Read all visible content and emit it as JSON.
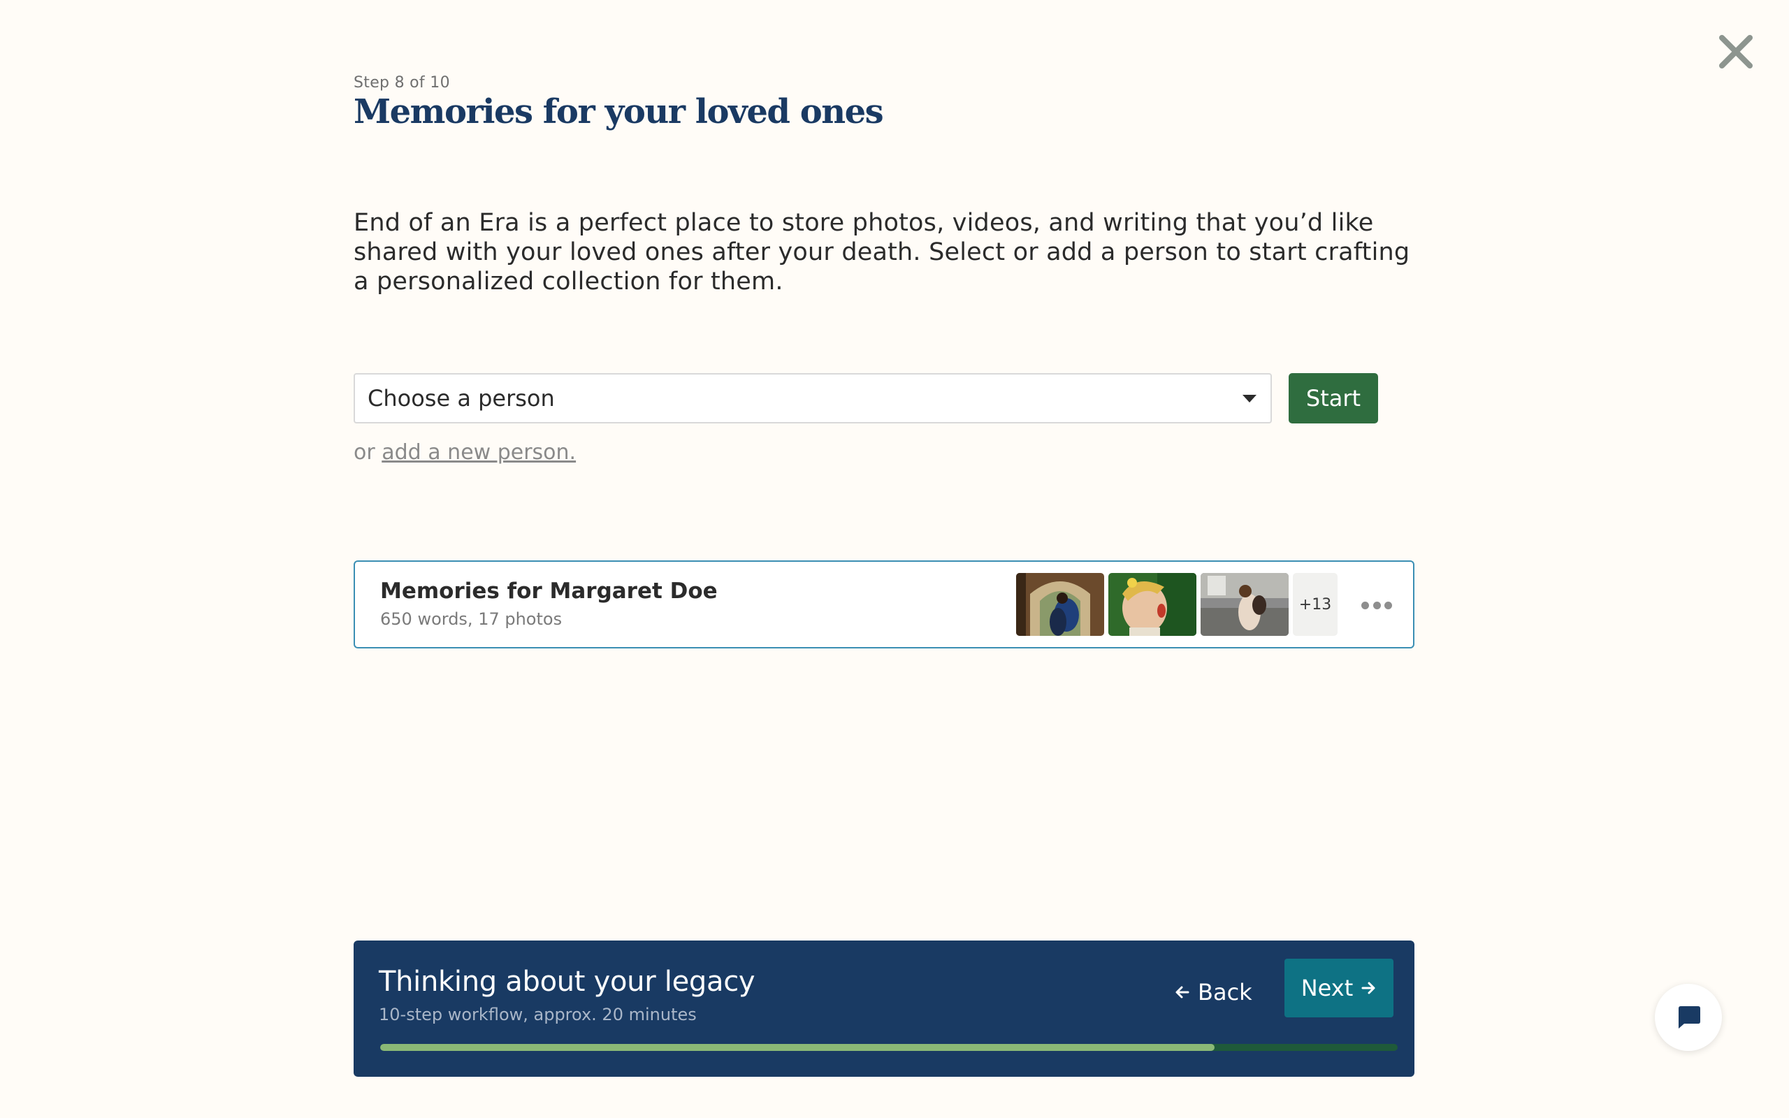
{
  "header": {
    "step_label": "Step 8 of 10",
    "title": "Memories for your loved ones",
    "close_icon": "close-x-icon"
  },
  "intro": {
    "text": "End of an Era is a perfect place to store photos, videos, and writing that you’d like shared with your loved ones after your death. Select or add a person to start crafting a personalized collection for them."
  },
  "person_picker": {
    "selected": "Choose a person",
    "start_label": "Start",
    "or_prefix": "or",
    "add_link": "add a new person."
  },
  "memory_card": {
    "title": "Memories for Margaret Doe",
    "meta": "650 words, 17 photos",
    "thumbnails": [
      "photo-arch-couple",
      "photo-child-painted-face",
      "photo-couple-stone-wall"
    ],
    "more_count": "+13",
    "menu_icon": "more-dots-icon"
  },
  "footer": {
    "title": "Thinking about your legacy",
    "subtitle": "10-step workflow, approx. 20 minutes",
    "back_label": "Back",
    "next_label": "Next",
    "progress": 0.82
  },
  "chat": {
    "icon": "chat-bubble-icon"
  },
  "colors": {
    "background": "#fffcf7",
    "title": "#1a3a63",
    "start_button": "#2f6d3f",
    "card_border": "#3b8fb4",
    "footer_bg": "#193a63",
    "next_button": "#0e7284",
    "progress_fill": "#8bb976",
    "progress_track": "#1f5a3a"
  }
}
